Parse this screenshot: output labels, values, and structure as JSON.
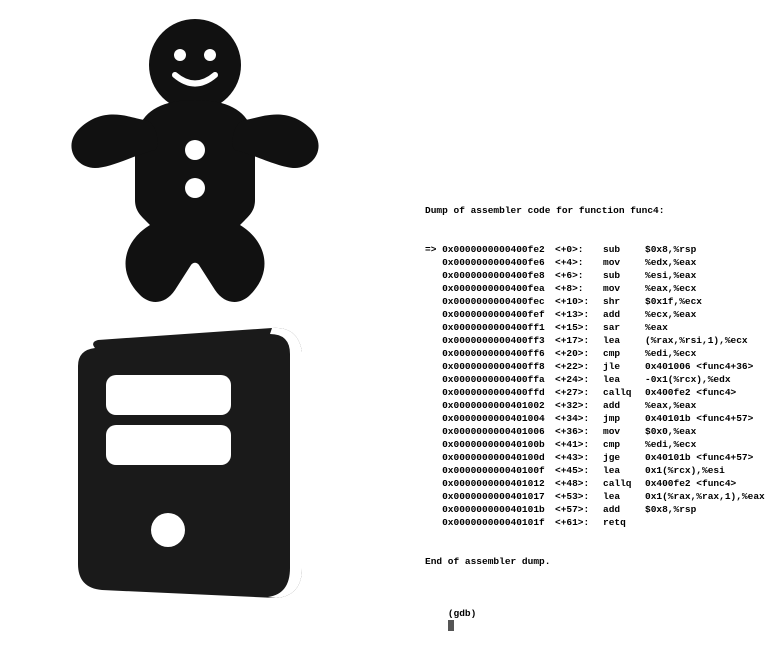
{
  "header": "Dump of assembler code for function func4:",
  "footer": "End of assembler dump.",
  "prompt": "(gdb) ",
  "marker": "=>",
  "lines": [
    {
      "addr": "0x0000000000400fe2",
      "off": "<+0>:",
      "mn": "sub",
      "ops": "$0x8,%rsp"
    },
    {
      "addr": "0x0000000000400fe6",
      "off": "<+4>:",
      "mn": "mov",
      "ops": "%edx,%eax"
    },
    {
      "addr": "0x0000000000400fe8",
      "off": "<+6>:",
      "mn": "sub",
      "ops": "%esi,%eax"
    },
    {
      "addr": "0x0000000000400fea",
      "off": "<+8>:",
      "mn": "mov",
      "ops": "%eax,%ecx"
    },
    {
      "addr": "0x0000000000400fec",
      "off": "<+10>:",
      "mn": "shr",
      "ops": "$0x1f,%ecx"
    },
    {
      "addr": "0x0000000000400fef",
      "off": "<+13>:",
      "mn": "add",
      "ops": "%ecx,%eax"
    },
    {
      "addr": "0x0000000000400ff1",
      "off": "<+15>:",
      "mn": "sar",
      "ops": "%eax"
    },
    {
      "addr": "0x0000000000400ff3",
      "off": "<+17>:",
      "mn": "lea",
      "ops": "(%rax,%rsi,1),%ecx"
    },
    {
      "addr": "0x0000000000400ff6",
      "off": "<+20>:",
      "mn": "cmp",
      "ops": "%edi,%ecx"
    },
    {
      "addr": "0x0000000000400ff8",
      "off": "<+22>:",
      "mn": "jle",
      "ops": "0x401006 <func4+36>"
    },
    {
      "addr": "0x0000000000400ffa",
      "off": "<+24>:",
      "mn": "lea",
      "ops": "-0x1(%rcx),%edx"
    },
    {
      "addr": "0x0000000000400ffd",
      "off": "<+27>:",
      "mn": "callq",
      "ops": "0x400fe2 <func4>"
    },
    {
      "addr": "0x0000000000401002",
      "off": "<+32>:",
      "mn": "add",
      "ops": "%eax,%eax"
    },
    {
      "addr": "0x0000000000401004",
      "off": "<+34>:",
      "mn": "jmp",
      "ops": "0x40101b <func4+57>"
    },
    {
      "addr": "0x0000000000401006",
      "off": "<+36>:",
      "mn": "mov",
      "ops": "$0x0,%eax"
    },
    {
      "addr": "0x000000000040100b",
      "off": "<+41>:",
      "mn": "cmp",
      "ops": "%edi,%ecx"
    },
    {
      "addr": "0x000000000040100d",
      "off": "<+43>:",
      "mn": "jge",
      "ops": "0x40101b <func4+57>"
    },
    {
      "addr": "0x000000000040100f",
      "off": "<+45>:",
      "mn": "lea",
      "ops": "0x1(%rcx),%esi"
    },
    {
      "addr": "0x0000000000401012",
      "off": "<+48>:",
      "mn": "callq",
      "ops": "0x400fe2 <func4>"
    },
    {
      "addr": "0x0000000000401017",
      "off": "<+53>:",
      "mn": "lea",
      "ops": "0x1(%rax,%rax,1),%eax"
    },
    {
      "addr": "0x000000000040101b",
      "off": "<+57>:",
      "mn": "add",
      "ops": "$0x8,%rsp"
    },
    {
      "addr": "0x000000000040101f",
      "off": "<+61>:",
      "mn": "retq",
      "ops": ""
    }
  ]
}
